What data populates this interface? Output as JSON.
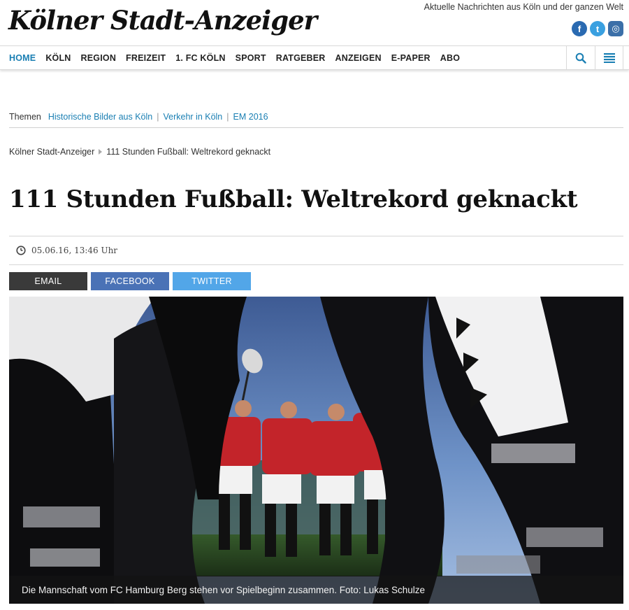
{
  "header": {
    "logo": "Kölner Stadt-Anzeiger",
    "tagline": "Aktuelle Nachrichten aus Köln und der ganzen Welt",
    "social": [
      {
        "name": "facebook",
        "glyph": "f"
      },
      {
        "name": "twitter",
        "glyph": "t"
      },
      {
        "name": "instagram",
        "glyph": "◎"
      }
    ]
  },
  "nav": {
    "items": [
      "HOME",
      "KÖLN",
      "REGION",
      "FREIZEIT",
      "1. FC KÖLN",
      "SPORT",
      "RATGEBER",
      "ANZEIGEN",
      "E-PAPER",
      "ABO"
    ],
    "active_index": 0,
    "accent_color": "#1a7fb3"
  },
  "themen": {
    "label": "Themen",
    "links": [
      "Historische Bilder aus Köln",
      "Verkehr in Köln",
      "EM 2016"
    ]
  },
  "breadcrumb": {
    "home": "Kölner Stadt-Anzeiger",
    "current": "111 Stunden Fußball: Weltrekord geknackt"
  },
  "article": {
    "title": "111 Stunden Fußball: Weltrekord geknackt",
    "date": "05.06.16, 13:46 Uhr"
  },
  "share": {
    "email": "EMAIL",
    "facebook": "FACEBOOK",
    "twitter": "TWITTER"
  },
  "photo": {
    "caption": "Die Mannschaft vom FC Hamburg Berg stehen vor Spielbeginn zusammen. Foto: Lukas Schulze"
  }
}
